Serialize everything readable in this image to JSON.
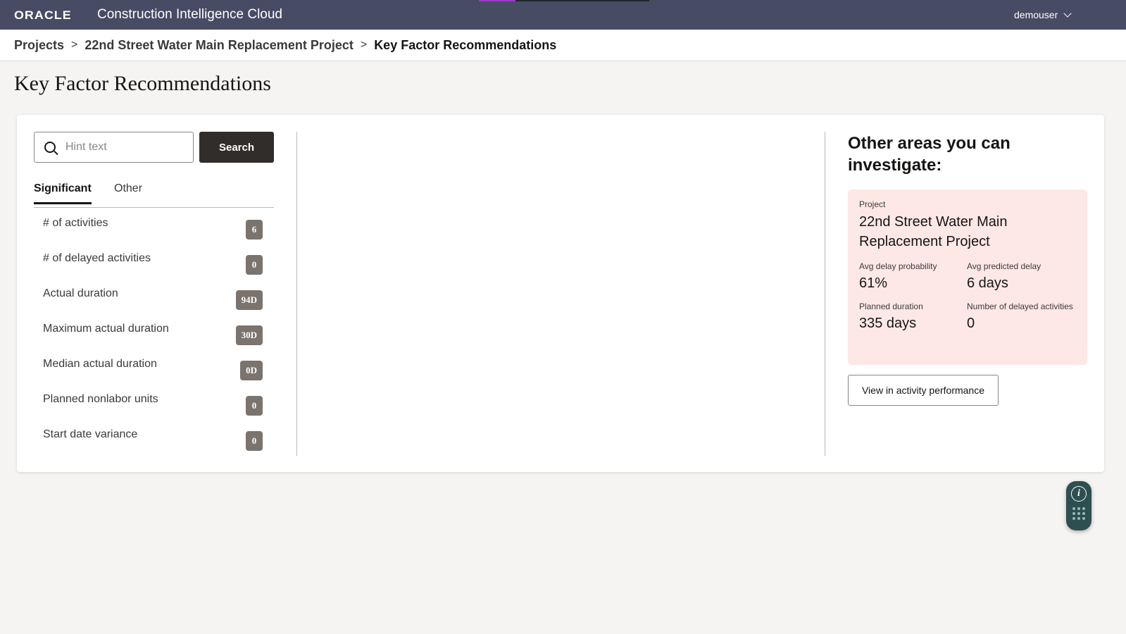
{
  "header": {
    "logo": "ORACLE",
    "app_title": "Construction Intelligence Cloud",
    "user": "demouser"
  },
  "breadcrumb": {
    "items": [
      "Projects",
      "22nd Street Water Main Replacement Project",
      "Key Factor Recommendations"
    ],
    "separator": ">"
  },
  "page": {
    "title": "Key Factor Recommendations"
  },
  "search": {
    "placeholder": "Hint text",
    "value": "",
    "button_label": "Search"
  },
  "tabs": [
    {
      "label": "Significant",
      "active": true
    },
    {
      "label": "Other",
      "active": false
    }
  ],
  "factors": [
    {
      "label": "# of activities",
      "badge": "6"
    },
    {
      "label": "# of delayed activities",
      "badge": "0"
    },
    {
      "label": "Actual duration",
      "badge": "94D"
    },
    {
      "label": "Maximum actual duration",
      "badge": "30D"
    },
    {
      "label": "Median actual duration",
      "badge": "0D"
    },
    {
      "label": "Planned nonlabor units",
      "badge": "0"
    },
    {
      "label": "Start date variance",
      "badge": "0"
    }
  ],
  "other_areas": {
    "title": "Other areas you can investigate:",
    "project_card": {
      "kicker": "Project",
      "name": "22nd Street Water Main Replacement Project",
      "metrics": [
        {
          "label": "Avg delay probability",
          "value": "61%"
        },
        {
          "label": "Avg predicted delay",
          "value": "6 days"
        },
        {
          "label": "Planned duration",
          "value": "335 days"
        },
        {
          "label": "Number of delayed activities",
          "value": "0"
        }
      ]
    },
    "view_button_label": "View in activity performance"
  },
  "floating_widget": {
    "info_glyph": "i"
  },
  "colors": {
    "topbar": "#474b63",
    "project_card_bg": "#fde8e6",
    "badge_bg": "#7a736e",
    "search_button_bg": "#312d2a",
    "widget_bg": "#2d4f4f"
  }
}
